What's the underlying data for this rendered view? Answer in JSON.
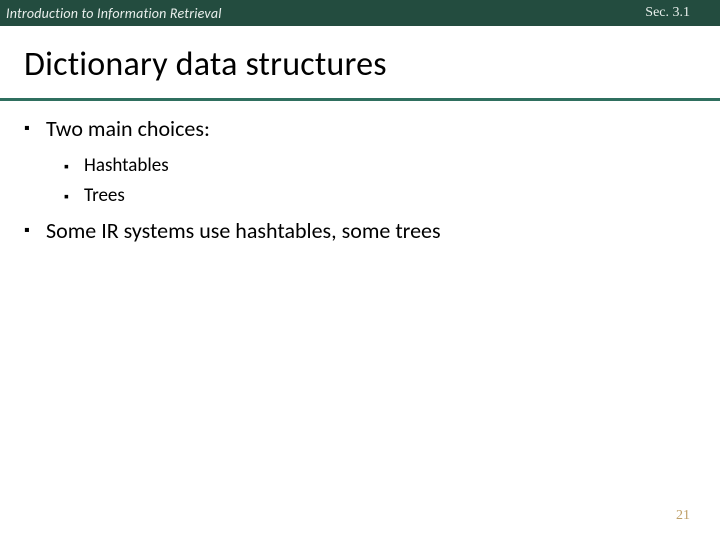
{
  "header": {
    "course": "Introduction to Information Retrieval",
    "section": "Sec. 3.1"
  },
  "title": "Dictionary data structures",
  "bullets": {
    "b1a": "Two main choices:",
    "b2a": "Hashtables",
    "b2b": "Trees",
    "b1b": "Some IR systems use hashtables, some trees"
  },
  "page_number": "21"
}
